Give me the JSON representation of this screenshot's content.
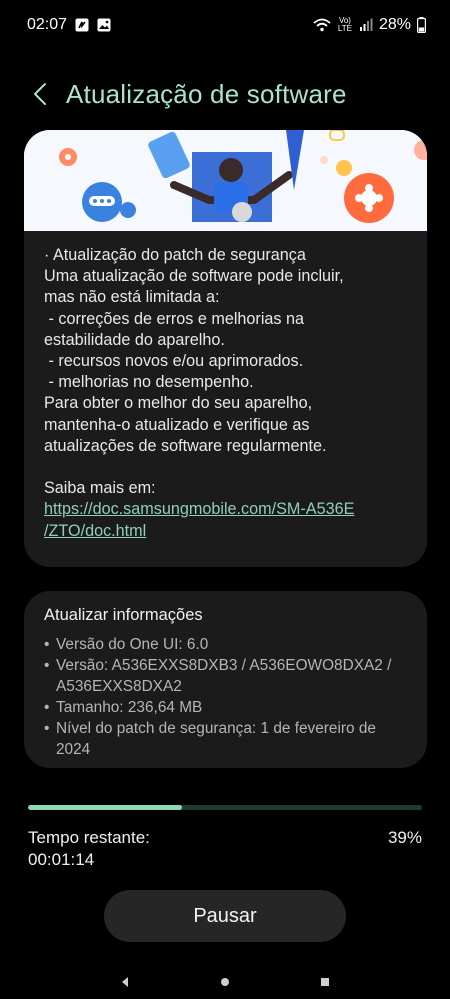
{
  "status_bar": {
    "time": "02:07",
    "lte_label": "Vo) LTE",
    "battery": "28%"
  },
  "header": {
    "title": "Atualização de software"
  },
  "notes": {
    "lines": [
      "· Atualização do patch de segurança",
      "Uma atualização de software pode incluir,",
      "mas não está limitada a:",
      " - correções de erros e melhorias na",
      "estabilidade do aparelho.",
      " - recursos novos e/ou aprimorados.",
      " - melhorias no desempenho.",
      "Para obter o melhor do seu aparelho,",
      "mantenha-o atualizado e verifique as",
      "atualizações de software regularmente."
    ],
    "more_label": "Saiba mais em:",
    "link_line1": "https://doc.samsungmobile.com/SM-A536E",
    "link_line2": "/ZTO/doc.html"
  },
  "info": {
    "title": "Atualizar informações",
    "items": [
      "Versão do One UI: 6.0",
      "Versão: A536EXXS8DXB3 / A536EOWO8DXA2 / A536EXXS8DXA2",
      "Tamanho: 236,64 MB",
      "Nível do patch de segurança: 1 de fevereiro de 2024"
    ]
  },
  "progress": {
    "percent_value": 0.39,
    "percent_label": "39%",
    "remaining_label": "Tempo restante:",
    "remaining_time": "00:01:14"
  },
  "actions": {
    "pause_label": "Pausar"
  },
  "colors": {
    "accent": "#a9e3cc",
    "progress_fill": "#8ed8b8",
    "progress_track": "#1f3a2f",
    "link": "#8fd0b7",
    "card_bg": "#1b1b1b"
  },
  "icons": {
    "status_left": [
      "nfc-icon",
      "gallery-icon"
    ],
    "status_right": [
      "wifi-icon",
      "signal-icon",
      "battery-icon"
    ],
    "nav": [
      "back-nav-icon",
      "home-nav-icon",
      "recents-nav-icon"
    ]
  }
}
